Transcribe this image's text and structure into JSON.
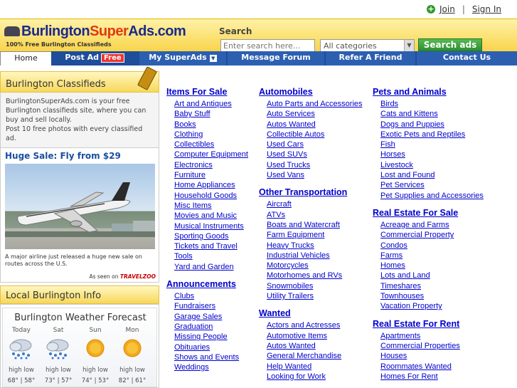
{
  "topbar": {
    "join": "Join",
    "sep": "|",
    "signin": "Sign In"
  },
  "header": {
    "logo_part1": "Burlington",
    "logo_part2": "Super",
    "logo_part3": "Ads.com",
    "tagline": "100% Free Burlington Classifieds",
    "search_label": "Search",
    "search_placeholder": "Enter search here...",
    "category_value": "All categories",
    "search_button": "Search ads"
  },
  "nav": {
    "home": "Home",
    "post_ad": "Post Ad",
    "free_badge": "Free",
    "my_superads": "My SuperAds",
    "forum": "Message Forum",
    "refer": "Refer A Friend",
    "contact": "Contact Us"
  },
  "sidebar": {
    "classifieds_title": "Burlington Classifieds",
    "classifieds_text1": "BurlingtonSuperAds.com is your free Burlington classifieds site, where you can buy and sell locally.",
    "classifieds_text2": "Post 10 free photos with every classified ad.",
    "promo_title": "Huge Sale: Fly from $29",
    "promo_caption": "A major airline just released a huge new sale on routes across the U.S.",
    "promo_seen": "As seen on",
    "promo_brand": "TRAVELZOO",
    "local_title": "Local Burlington Info",
    "weather_title": "Burlington Weather Forecast",
    "weather": [
      {
        "day": "Today",
        "icon": "rain-cloud-icon",
        "hl": "high  low",
        "temps": "68° | 58°"
      },
      {
        "day": "Sat",
        "icon": "rain-cloud-icon",
        "hl": "high  low",
        "temps": "73° | 57°"
      },
      {
        "day": "Sun",
        "icon": "sun-icon",
        "hl": "high  low",
        "temps": "74° | 53°"
      },
      {
        "day": "Mon",
        "icon": "sun-icon",
        "hl": "high  low",
        "temps": "82° | 61°"
      }
    ]
  },
  "columns": [
    [
      {
        "title": "Items For Sale",
        "items": [
          "Art and Antiques",
          "Baby Stuff",
          "Books",
          "Clothing",
          "Collectibles",
          "Computer Equipment",
          "Electronics",
          "Furniture",
          "Home Appliances",
          "Household Goods",
          "Misc Items",
          "Movies and Music",
          "Musical Instruments",
          "Sporting Goods",
          "Tickets and Travel",
          "Tools",
          "Yard and Garden"
        ]
      },
      {
        "title": "Announcements",
        "items": [
          "Clubs",
          "Fundraisers",
          "Garage Sales",
          "Graduation",
          "Missing People",
          "Obituaries",
          "Shows and Events",
          "Weddings"
        ]
      }
    ],
    [
      {
        "title": "Automobiles",
        "items": [
          "Auto Parts and Accessories",
          "Auto Services",
          "Autos Wanted",
          "Collectible Autos",
          "Used Cars",
          "Used SUVs",
          "Used Trucks",
          "Used Vans"
        ]
      },
      {
        "title": "Other Transportation",
        "items": [
          "Aircraft",
          "ATVs",
          "Boats and Watercraft",
          "Farm Equipment",
          "Heavy Trucks",
          "Industrial Vehicles",
          "Motorcycles",
          "Motorhomes and RVs",
          "Snowmobiles",
          "Utility Trailers"
        ]
      },
      {
        "title": "Wanted",
        "items": [
          "Actors and Actresses",
          "Automotive Items",
          "Autos Wanted",
          "General Merchandise",
          "Help Wanted",
          "Looking for Work"
        ]
      }
    ],
    [
      {
        "title": "Pets and Animals",
        "items": [
          "Birds",
          "Cats and Kittens",
          "Dogs and Puppies",
          "Exotic Pets and Reptiles",
          "Fish",
          "Horses",
          "Livestock",
          "Lost and Found",
          "Pet Services",
          "Pet Supplies and Accessories"
        ]
      },
      {
        "title": "Real Estate For Sale",
        "items": [
          "Acreage and Farms",
          "Commercial Property",
          "Condos",
          "Farms",
          "Homes",
          "Lots and Land",
          "Timeshares",
          "Townhouses",
          "Vacation Property"
        ]
      },
      {
        "title": "Real Estate For Rent",
        "items": [
          "Apartments",
          "Commercial Properties",
          "Houses",
          "Roommates Wanted",
          "Homes For Rent"
        ]
      }
    ]
  ]
}
